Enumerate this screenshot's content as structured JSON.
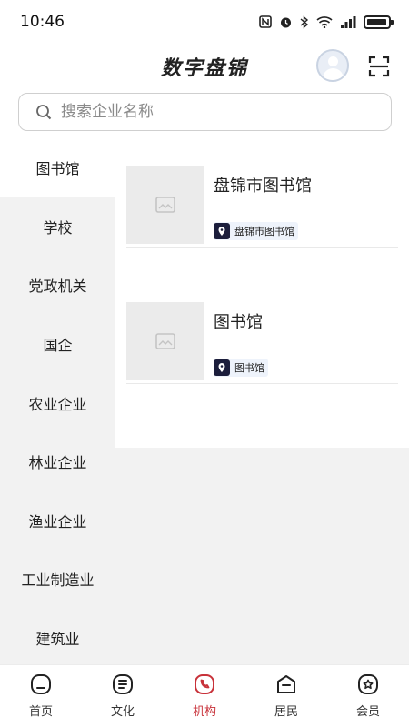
{
  "status_bar": {
    "time": "10:46",
    "icons": [
      "nfc-icon",
      "alarm-icon",
      "bluetooth-icon",
      "wifi-icon",
      "signal-icon",
      "battery-icon"
    ]
  },
  "header": {
    "title": "数字盘锦",
    "avatar_icon": "avatar-placeholder-icon",
    "scan_icon": "scan-icon"
  },
  "search": {
    "placeholder": "搜索企业名称",
    "icon": "search-icon"
  },
  "categories": [
    {
      "label": "图书馆",
      "active": true
    },
    {
      "label": "学校"
    },
    {
      "label": "党政机关"
    },
    {
      "label": "国企"
    },
    {
      "label": "农业企业"
    },
    {
      "label": "林业企业"
    },
    {
      "label": "渔业企业"
    },
    {
      "label": "工业制造业"
    },
    {
      "label": "建筑业"
    }
  ],
  "organizations": [
    {
      "name": "盘锦市图书馆",
      "tag": "盘锦市图书馆",
      "thumb_icon": "image-placeholder-icon",
      "tag_icon": "location-pin-icon"
    },
    {
      "name": "图书馆",
      "tag": "图书馆",
      "thumb_icon": "image-placeholder-icon",
      "tag_icon": "location-pin-icon"
    }
  ],
  "tabs": [
    {
      "label": "首页",
      "icon": "home-icon"
    },
    {
      "label": "文化",
      "icon": "culture-icon"
    },
    {
      "label": "机构",
      "icon": "institution-icon",
      "active": true
    },
    {
      "label": "居民",
      "icon": "residents-icon"
    },
    {
      "label": "会员",
      "icon": "member-icon"
    }
  ],
  "colors": {
    "accent": "#c8323a",
    "sidebar_bg": "#f2f2f2",
    "tag_pin": "#1c1e3c",
    "tag_bg": "#eef3fb"
  }
}
